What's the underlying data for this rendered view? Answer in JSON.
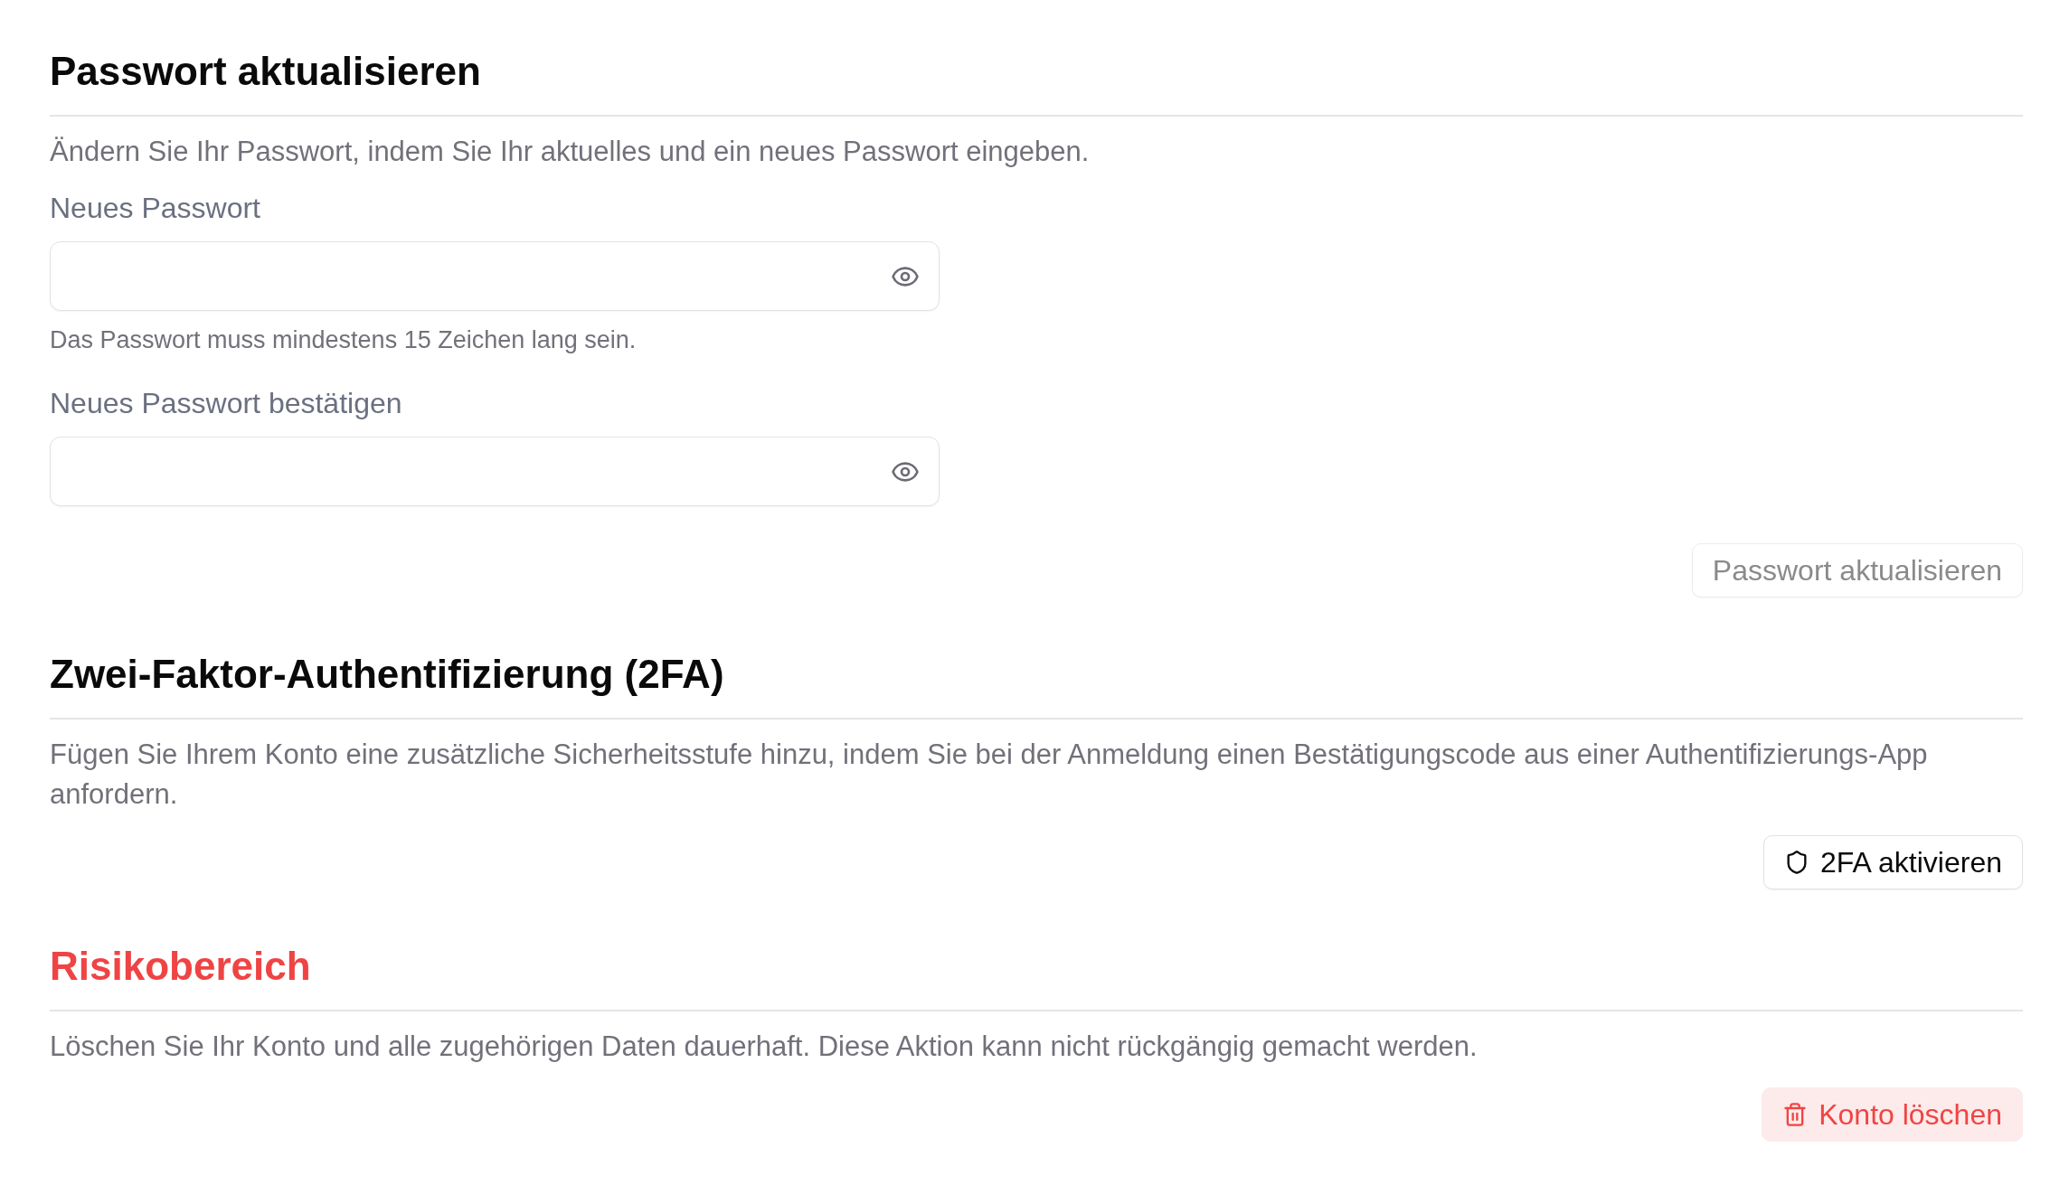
{
  "sections": [
    {
      "kind": "standard",
      "title": "Passwort aktualisieren",
      "description": "Ändern Sie Ihr Passwort, indem Sie Ihr aktuelles und ein neues Passwort eingeben.",
      "fields": [
        {
          "label": "Neues Passwort",
          "hint": "Das Passwort muss mindestens 15 Zeichen lang sein."
        },
        {
          "label": "Neues Passwort bestätigen"
        }
      ],
      "button": {
        "kind": "submit",
        "label": "Passwort aktualisieren",
        "disabled": true
      }
    },
    {
      "kind": "standard",
      "title": "Zwei-Faktor-Authentifizierung (2FA)",
      "description": "Fügen Sie Ihrem Konto eine zusätzliche Sicherheitsstufe hinzu, indem Sie bei der Anmeldung einen Bestätigungscode aus einer Authentifizierungs-App anfordern.",
      "button": {
        "kind": "security",
        "label": "2FA aktivieren",
        "disabled": false
      }
    },
    {
      "kind": "danger",
      "title": "Risikobereich",
      "description": "Löschen Sie Ihr Konto und alle zugehörigen Daten dauerhaft. Diese Aktion kann nicht rückgängig gemacht werden.",
      "button": {
        "kind": "danger",
        "label": "Konto löschen",
        "disabled": false
      }
    }
  ]
}
